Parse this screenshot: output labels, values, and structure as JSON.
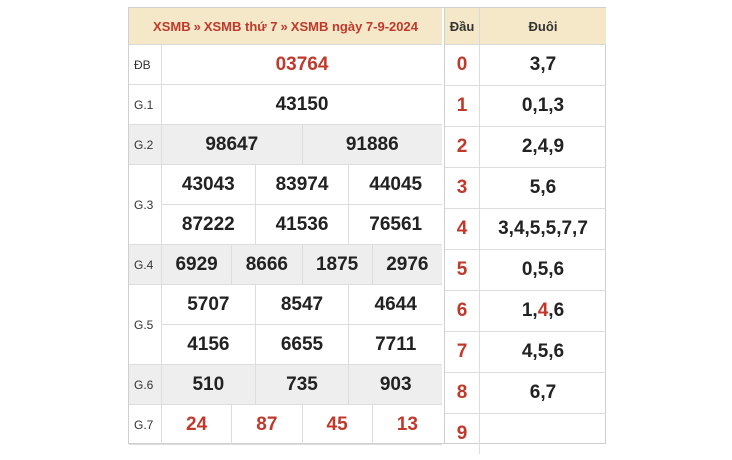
{
  "breadcrumb": [
    "XSMB",
    "XSMB thứ 7",
    "XSMB ngày 7-9-2024"
  ],
  "breadcrumb_sep": "»",
  "prizes": [
    {
      "label": "ĐB",
      "lines": [
        [
          "03764"
        ]
      ],
      "red": true,
      "gray": false
    },
    {
      "label": "G.1",
      "lines": [
        [
          "43150"
        ]
      ],
      "red": false,
      "gray": false
    },
    {
      "label": "G.2",
      "lines": [
        [
          "98647",
          "91886"
        ]
      ],
      "red": false,
      "gray": true
    },
    {
      "label": "G.3",
      "lines": [
        [
          "43043",
          "83974",
          "44045"
        ],
        [
          "87222",
          "41536",
          "76561"
        ]
      ],
      "red": false,
      "gray": false
    },
    {
      "label": "G.4",
      "lines": [
        [
          "6929",
          "8666",
          "1875",
          "2976"
        ]
      ],
      "red": false,
      "gray": true
    },
    {
      "label": "G.5",
      "lines": [
        [
          "5707",
          "8547",
          "4644"
        ],
        [
          "4156",
          "6655",
          "7711"
        ]
      ],
      "red": false,
      "gray": false
    },
    {
      "label": "G.6",
      "lines": [
        [
          "510",
          "735",
          "903"
        ]
      ],
      "red": false,
      "gray": true
    },
    {
      "label": "G.7",
      "lines": [
        [
          "24",
          "87",
          "45",
          "13"
        ]
      ],
      "red": true,
      "gray": false
    }
  ],
  "loto_header": {
    "dau": "Đầu",
    "duoi": "Đuôi"
  },
  "loto": [
    {
      "dau": "0",
      "duoi": "3,7"
    },
    {
      "dau": "1",
      "duoi": "0,1,3"
    },
    {
      "dau": "2",
      "duoi": "2,4,9"
    },
    {
      "dau": "3",
      "duoi": "5,6"
    },
    {
      "dau": "4",
      "duoi": "3,4,5,5,7,7"
    },
    {
      "dau": "5",
      "duoi": "0,5,6"
    },
    {
      "dau": "6",
      "duoi": "1,4,6",
      "highlight_index": 1
    },
    {
      "dau": "7",
      "duoi": "4,5,6"
    },
    {
      "dau": "8",
      "duoi": "6,7"
    },
    {
      "dau": "9",
      "duoi": ""
    }
  ],
  "colors": {
    "accent": "#c0392b",
    "header_bg": "#f4e8c8",
    "gray_row": "#eeeeee"
  }
}
